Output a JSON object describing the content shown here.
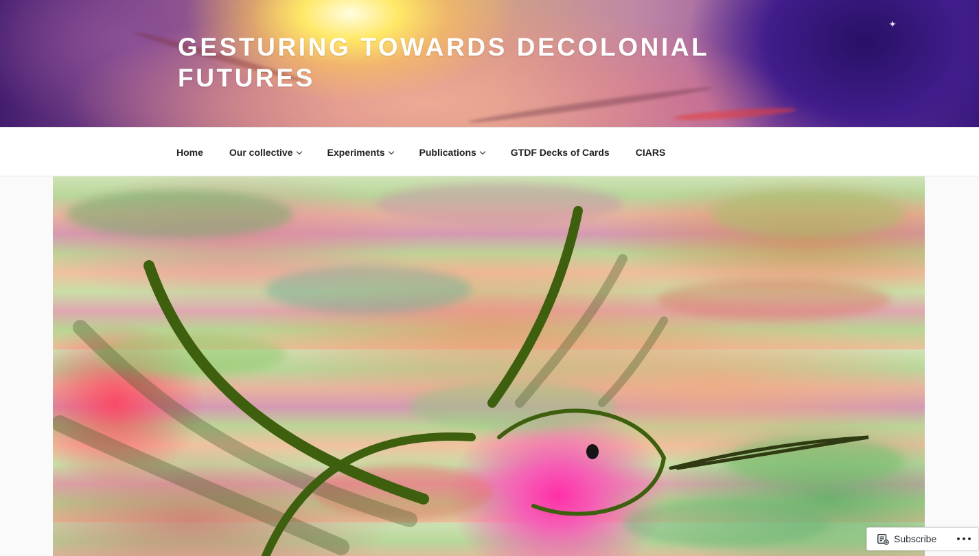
{
  "site": {
    "title": "GESTURING TOWARDS DECOLONIAL FUTURES",
    "header_image": "colorful-abstract-sun-painting-banner"
  },
  "nav": {
    "items": [
      {
        "label": "Home",
        "has_submenu": false
      },
      {
        "label": "Our collective",
        "has_submenu": true
      },
      {
        "label": "Experiments",
        "has_submenu": true
      },
      {
        "label": "Publications",
        "has_submenu": true
      },
      {
        "label": "GTDF Decks of Cards",
        "has_submenu": false
      },
      {
        "label": "CIARS",
        "has_submenu": false
      }
    ]
  },
  "featured": {
    "image": "watercolor-hummingbird-painting"
  },
  "subscribe_bar": {
    "subscribe_label": "Subscribe",
    "icon": "reader-subscribe-icon",
    "more_icon": "ellipsis-icon"
  },
  "colors": {
    "nav_text": "#222222",
    "title_text": "#ffffff",
    "page_bg": "#fafafa",
    "painting_line": "#3d5f0e"
  }
}
